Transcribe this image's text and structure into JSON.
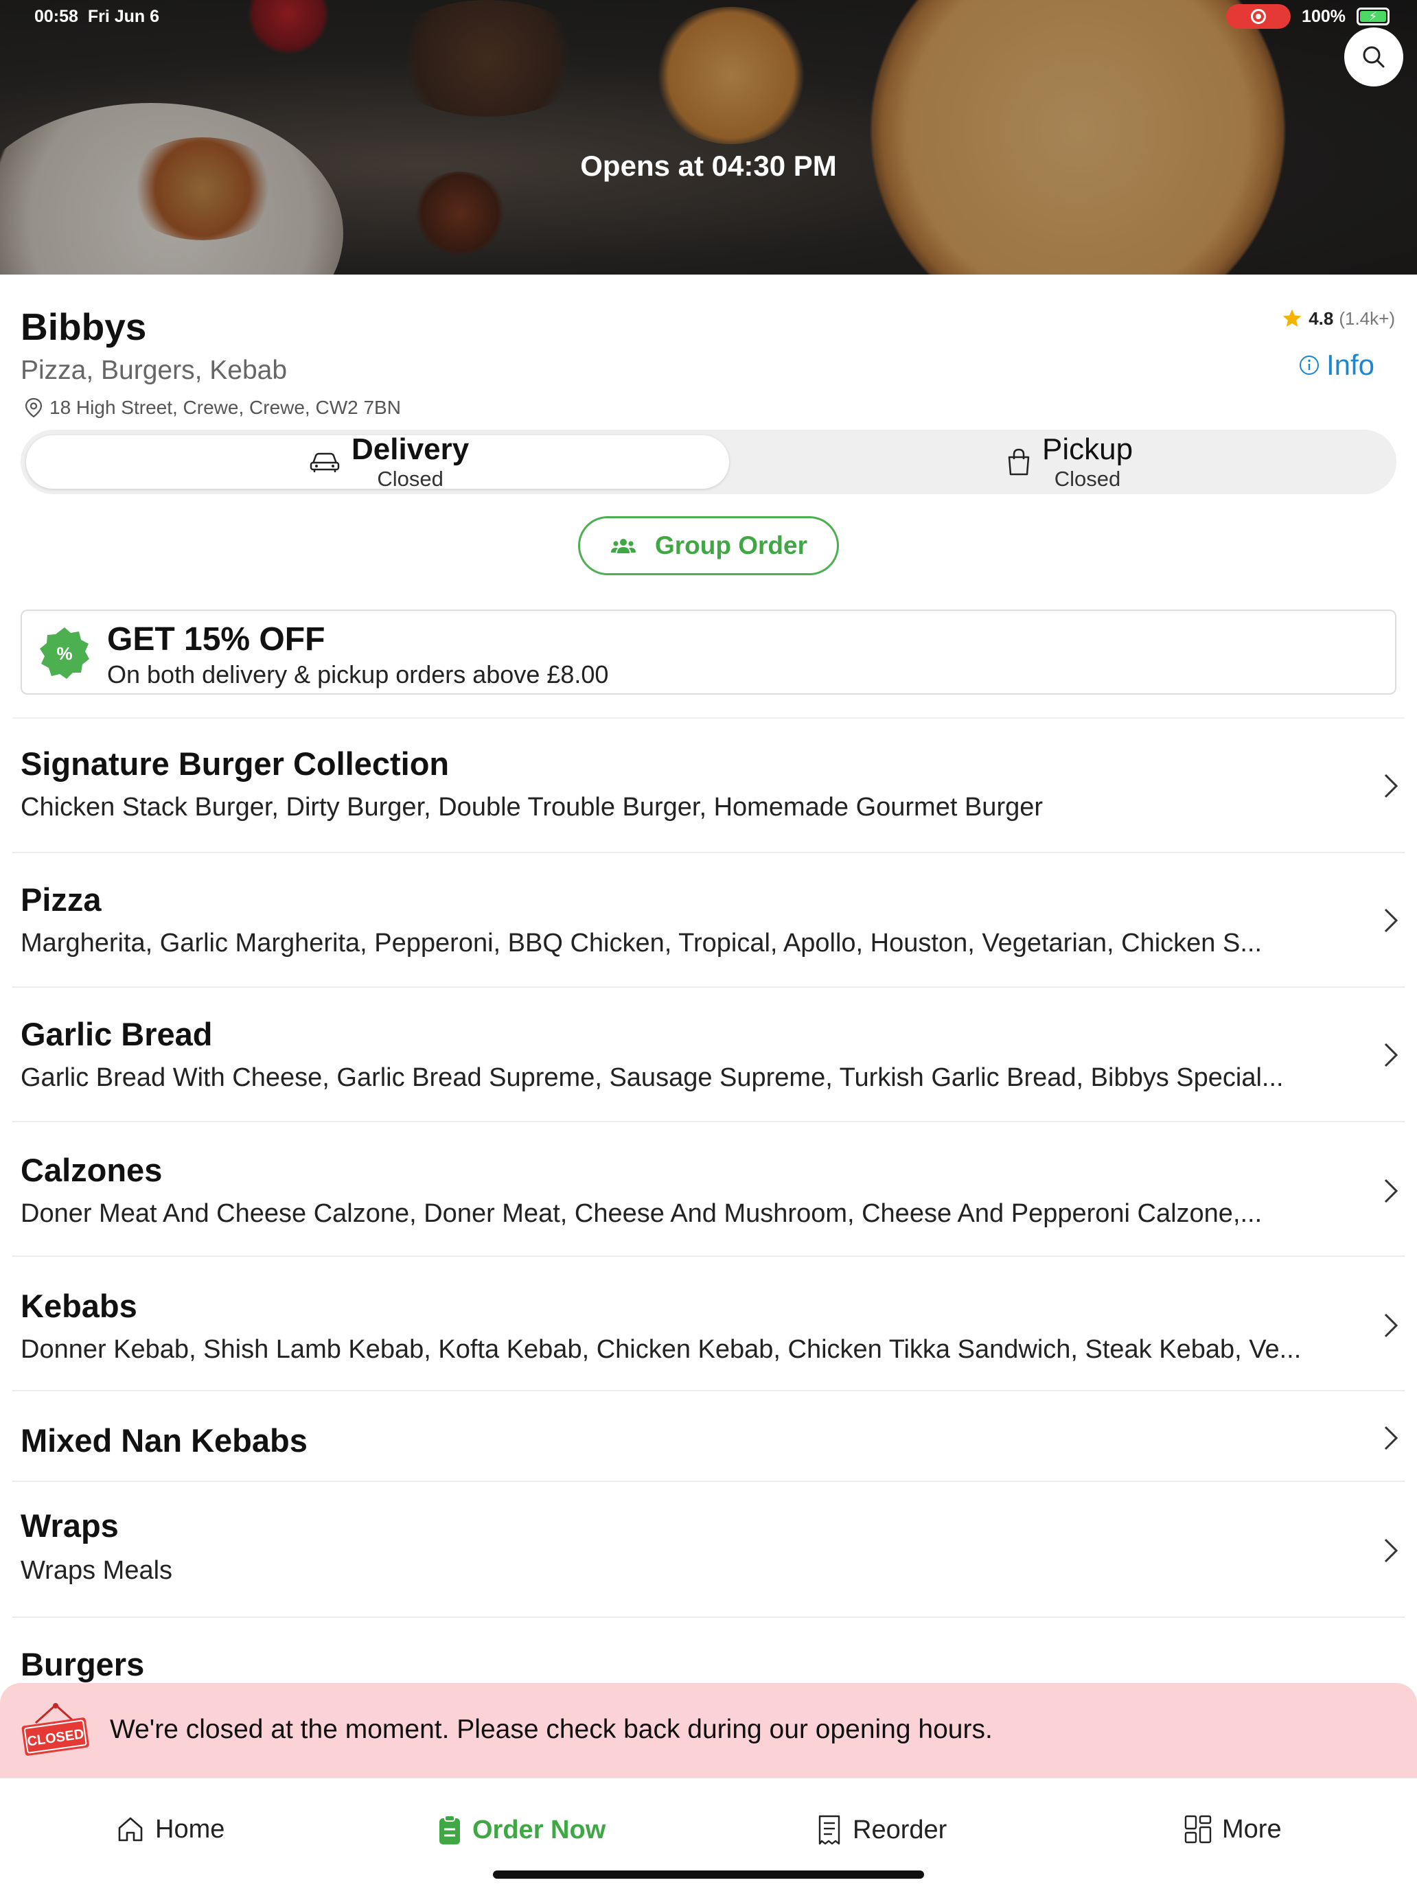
{
  "status_bar": {
    "time": "00:58",
    "date": "Fri Jun 6",
    "battery": "100%"
  },
  "hero": {
    "opens_text": "Opens at 04:30 PM"
  },
  "restaurant": {
    "name": "Bibbys",
    "cuisine": "Pizza, Burgers, Kebab",
    "address": "18 High Street, Crewe, Crewe, CW2 7BN",
    "rating": "4.8",
    "rating_count": "(1.4k+)",
    "info_label": "Info"
  },
  "modes": {
    "delivery": {
      "label": "Delivery",
      "status": "Closed",
      "selected": true
    },
    "pickup": {
      "label": "Pickup",
      "status": "Closed",
      "selected": false
    }
  },
  "group_order_label": "Group Order",
  "promo": {
    "title": "GET 15% OFF",
    "subtitle": "On both delivery & pickup orders above £8.00"
  },
  "categories": [
    {
      "name": "Signature Burger Collection",
      "items": "Chicken Stack Burger, Dirty Burger, Double Trouble Burger, Homemade Gourmet  Burger"
    },
    {
      "name": "Pizza",
      "items": "Margherita, Garlic Margherita, Pepperoni, BBQ Chicken, Tropical, Apollo, Houston, Vegetarian, Chicken S..."
    },
    {
      "name": "Garlic Bread",
      "items": "Garlic Bread With Cheese, Garlic Bread Supreme, Sausage Supreme, Turkish Garlic Bread, Bibbys Special..."
    },
    {
      "name": "Calzones",
      "items": "Doner Meat And Cheese Calzone, Doner Meat, Cheese And Mushroom, Cheese And Pepperoni Calzone,..."
    },
    {
      "name": "Kebabs",
      "items": "Donner Kebab, Shish Lamb Kebab, Kofta Kebab, Chicken Kebab, Chicken Tikka Sandwich, Steak Kebab, Ve..."
    },
    {
      "name": "Mixed Nan Kebabs",
      "items": ""
    },
    {
      "name": "Wraps",
      "items": "Wraps Meals"
    },
    {
      "name": "Burgers",
      "items": ""
    }
  ],
  "closed_banner": {
    "sign_text": "CLOSED",
    "message": "We're closed at the moment. Please check back during our opening hours."
  },
  "bottom_nav": {
    "home": "Home",
    "order_now": "Order Now",
    "reorder": "Reorder",
    "more": "More"
  },
  "colors": {
    "accent_green": "#3fa844",
    "info_blue": "#1a86d4",
    "banner_pink": "#fbd3d6",
    "record_red": "#e53935"
  }
}
